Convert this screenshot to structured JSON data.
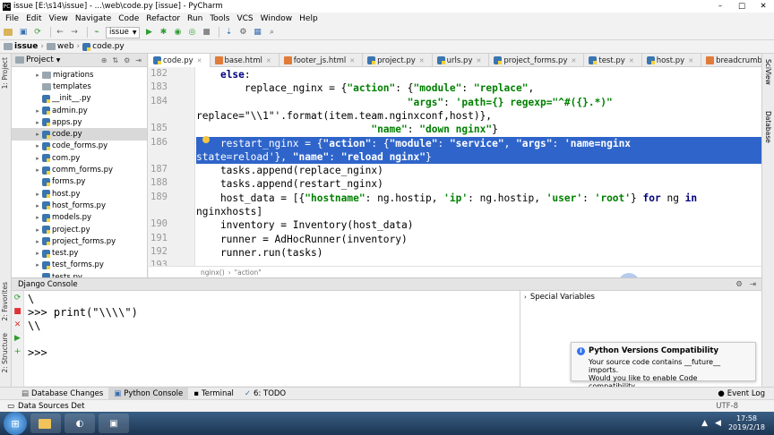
{
  "window": {
    "title": "issue [E:\\s14\\issue] - ...\\web\\code.py [issue] - PyCharm",
    "controls": [
      "–",
      "□",
      "✕"
    ]
  },
  "menu": [
    "File",
    "Edit",
    "View",
    "Navigate",
    "Code",
    "Refactor",
    "Run",
    "Tools",
    "VCS",
    "Window",
    "Help"
  ],
  "toolbar": {
    "run_config": "issue"
  },
  "breadcrumbs": [
    "issue",
    "web",
    "code.py"
  ],
  "project": {
    "header": "Project",
    "items": [
      {
        "label": "migrations",
        "kind": "folder",
        "arrow": "▸"
      },
      {
        "label": "templates",
        "kind": "folder",
        "arrow": ""
      },
      {
        "label": "__init__.py",
        "kind": "py",
        "arrow": ""
      },
      {
        "label": "admin.py",
        "kind": "py",
        "arrow": "▸"
      },
      {
        "label": "apps.py",
        "kind": "py",
        "arrow": "▸"
      },
      {
        "label": "code.py",
        "kind": "py",
        "arrow": "▸",
        "selected": true
      },
      {
        "label": "code_forms.py",
        "kind": "py",
        "arrow": "▸"
      },
      {
        "label": "com.py",
        "kind": "py",
        "arrow": "▸"
      },
      {
        "label": "comm_forms.py",
        "kind": "py",
        "arrow": "▸"
      },
      {
        "label": "forms.py",
        "kind": "py",
        "arrow": ""
      },
      {
        "label": "host.py",
        "kind": "py",
        "arrow": "▸"
      },
      {
        "label": "host_forms.py",
        "kind": "py",
        "arrow": "▸"
      },
      {
        "label": "models.py",
        "kind": "py",
        "arrow": "▸"
      },
      {
        "label": "project.py",
        "kind": "py",
        "arrow": "▸"
      },
      {
        "label": "project_forms.py",
        "kind": "py",
        "arrow": "▸"
      },
      {
        "label": "test.py",
        "kind": "py",
        "arrow": "▸"
      },
      {
        "label": "test_forms.py",
        "kind": "py",
        "arrow": "▸"
      },
      {
        "label": "tests.py",
        "kind": "py",
        "arrow": ""
      }
    ]
  },
  "tabs": [
    {
      "label": "code.py",
      "kind": "py",
      "active": true
    },
    {
      "label": "base.html",
      "kind": "html"
    },
    {
      "label": "footer_js.html",
      "kind": "html"
    },
    {
      "label": "project.py",
      "kind": "py"
    },
    {
      "label": "urls.py",
      "kind": "py"
    },
    {
      "label": "project_forms.py",
      "kind": "py"
    },
    {
      "label": "test.py",
      "kind": "py"
    },
    {
      "label": "host.py",
      "kind": "py"
    },
    {
      "label": "breadcrumb.html",
      "kind": "html"
    }
  ],
  "code": {
    "lines": [
      {
        "num": "182",
        "html": "    <span class='kw'>else</span>:"
      },
      {
        "num": "183",
        "html": "        replace_nginx = {<span class='str'>\"action\"</span>: {<span class='str'>\"module\"</span>: <span class='str'>\"replace\"</span>,"
      },
      {
        "num": "184",
        "html": "                                   <span class='str'>\"args\"</span>: <span class='str'>'path={} regexp=\"^#({}.*)\"</span>"
      },
      {
        "num": "",
        "html": "replace=\"\\\\1\"'</span>.format(item.team.nginxconf,host)},"
      },
      {
        "num": "185",
        "html": "                             <span class='str'>\"name\"</span>: <span class='str'>\"down nginx\"</span>}"
      },
      {
        "num": "186",
        "html": "    restart_nginx = {<span class='str'>\"action\"</span>: {<span class='str'>\"module\"</span>: <span class='str'>\"service\"</span>, <span class='str'>\"args\"</span>: <span class='str'>'name=nginx</span>",
        "hl": true
      },
      {
        "num": "",
        "html": "state=reload'</span>}, <span class='str'>\"name\"</span>: <span class='str'>\"reload nginx\"</span>}",
        "hl": true
      },
      {
        "num": "187",
        "html": "    tasks.append(replace_nginx)"
      },
      {
        "num": "188",
        "html": "    tasks.append(restart_nginx)"
      },
      {
        "num": "189",
        "html": "    host_data = [{<span class='str'>\"hostname\"</span>: ng.hostip, <span class='str'>'ip'</span>: ng.hostip, <span class='str'>'user'</span>: <span class='str'>'root'</span>} <span class='kw'>for</span> ng <span class='kw'>in</span>"
      },
      {
        "num": "",
        "html": "nginxhosts]"
      },
      {
        "num": "190",
        "html": "    inventory = Inventory(host_data)"
      },
      {
        "num": "191",
        "html": "    runner = AdHocRunner(inventory)"
      },
      {
        "num": "192",
        "html": "    runner.run(tasks)"
      },
      {
        "num": "193",
        "html": ""
      }
    ],
    "breadcrumb": [
      "nginx()",
      "\"action\""
    ]
  },
  "console": {
    "title": "Django Console",
    "output": [
      "\\",
      ">>> print(\"\\\\\\\\\")",
      "\\\\",
      "",
      ">>>"
    ],
    "variables_label": "Special Variables"
  },
  "popup": {
    "title": "Python Versions Compatibility",
    "line1": "Your source code contains __future__ imports.",
    "line2": "Would you like to enable Code compatibility..."
  },
  "left_vtabs": [
    "1: Project",
    "2: Favorites",
    "2: Structure"
  ],
  "right_vtabs": [
    "SciView",
    "Database"
  ],
  "bottom_tabs": [
    "Database Changes",
    "Python Console",
    "Terminal",
    "6: TODO"
  ],
  "event_log": "Event Log",
  "status": {
    "left": "Data Sources Det",
    "encoding": "UTF-8"
  },
  "clock": {
    "time": "17:58",
    "date": "2019/2/18"
  }
}
